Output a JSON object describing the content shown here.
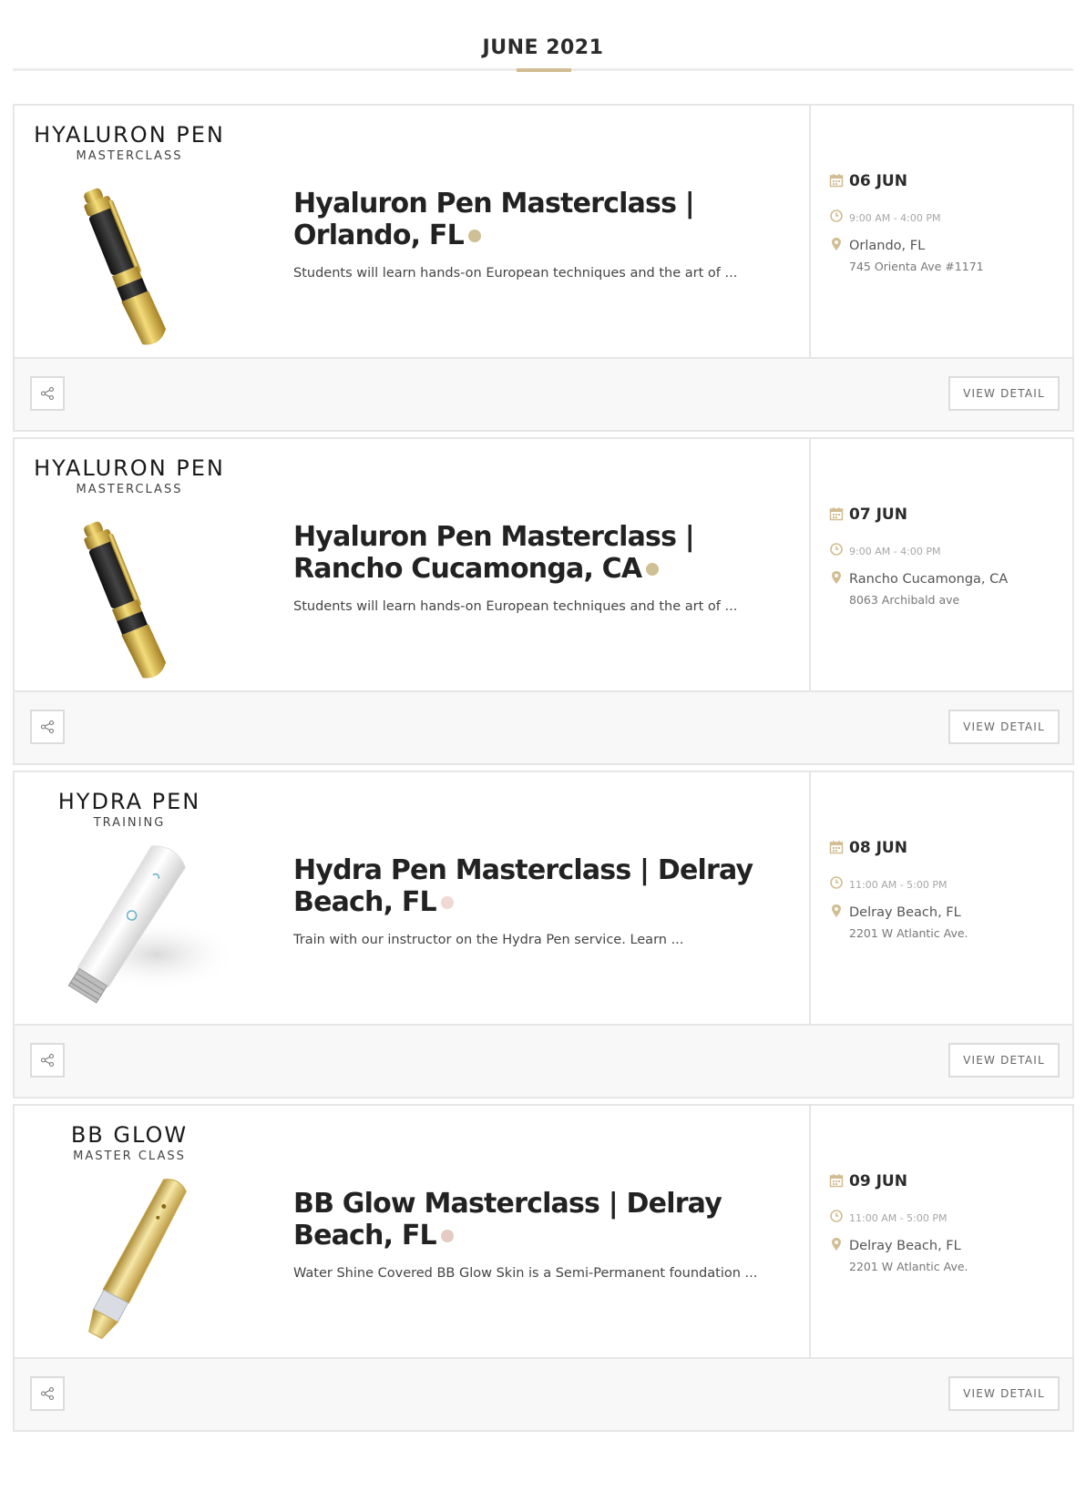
{
  "month_header": {
    "title": "JUNE 2021",
    "accent_color": "#d2bd92"
  },
  "events": [
    {
      "logo_title": "HYALURON PEN",
      "logo_subtitle": "MASTERCLASS",
      "product_icon": "gold-black-pen-icon",
      "title": "Hyaluron Pen Masterclass | Orlando, FL",
      "dot_color": "#cfbf95",
      "description": "Students will learn hands-on European techniques and the art of ...",
      "date": "06 JUN",
      "time": "9:00 AM - 4:00 PM",
      "city": "Orlando, FL",
      "address": "745 Orienta Ave #1171",
      "view_label": "VIEW DETAIL"
    },
    {
      "logo_title": "HYALURON PEN",
      "logo_subtitle": "MASTERCLASS",
      "product_icon": "gold-black-pen-icon",
      "title": "Hyaluron Pen Masterclass | Rancho Cucamonga, CA",
      "dot_color": "#cfbf95",
      "description": "Students will learn hands-on European techniques and the art of ...",
      "date": "07 JUN",
      "time": "9:00 AM - 4:00 PM",
      "city": "Rancho Cucamonga, CA",
      "address": "8063 Archibald ave",
      "view_label": "VIEW DETAIL"
    },
    {
      "logo_title": "HYDRA PEN",
      "logo_subtitle": "TRAINING",
      "product_icon": "white-hydra-pen-icon",
      "title": "Hydra Pen Masterclass | Delray Beach, FL",
      "dot_color": "#efd9d2",
      "description": "Train with our instructor on the Hydra Pen service. Learn ...",
      "date": "08 JUN",
      "time": "11:00 AM - 5:00 PM",
      "city": "Delray Beach, FL",
      "address": "2201 W Atlantic Ave.",
      "view_label": "VIEW DETAIL"
    },
    {
      "logo_title": "BB GLOW",
      "logo_subtitle": "MASTER CLASS",
      "product_icon": "gold-microneedle-pen-icon",
      "title": "BB Glow Masterclass | Delray Beach, FL",
      "dot_color": "#e5cbc2",
      "description": "Water Shine Covered BB Glow Skin is a Semi-Permanent foundation ...",
      "date": "09 JUN",
      "time": "11:00 AM - 5:00 PM",
      "city": "Delray Beach, FL",
      "address": "2201 W Atlantic Ave.",
      "view_label": "VIEW DETAIL"
    }
  ],
  "icons": {
    "date": "calendar-icon",
    "time": "clock-icon",
    "location": "map-pin-icon",
    "share": "share-icon",
    "icon_color": "#d2bd92"
  }
}
